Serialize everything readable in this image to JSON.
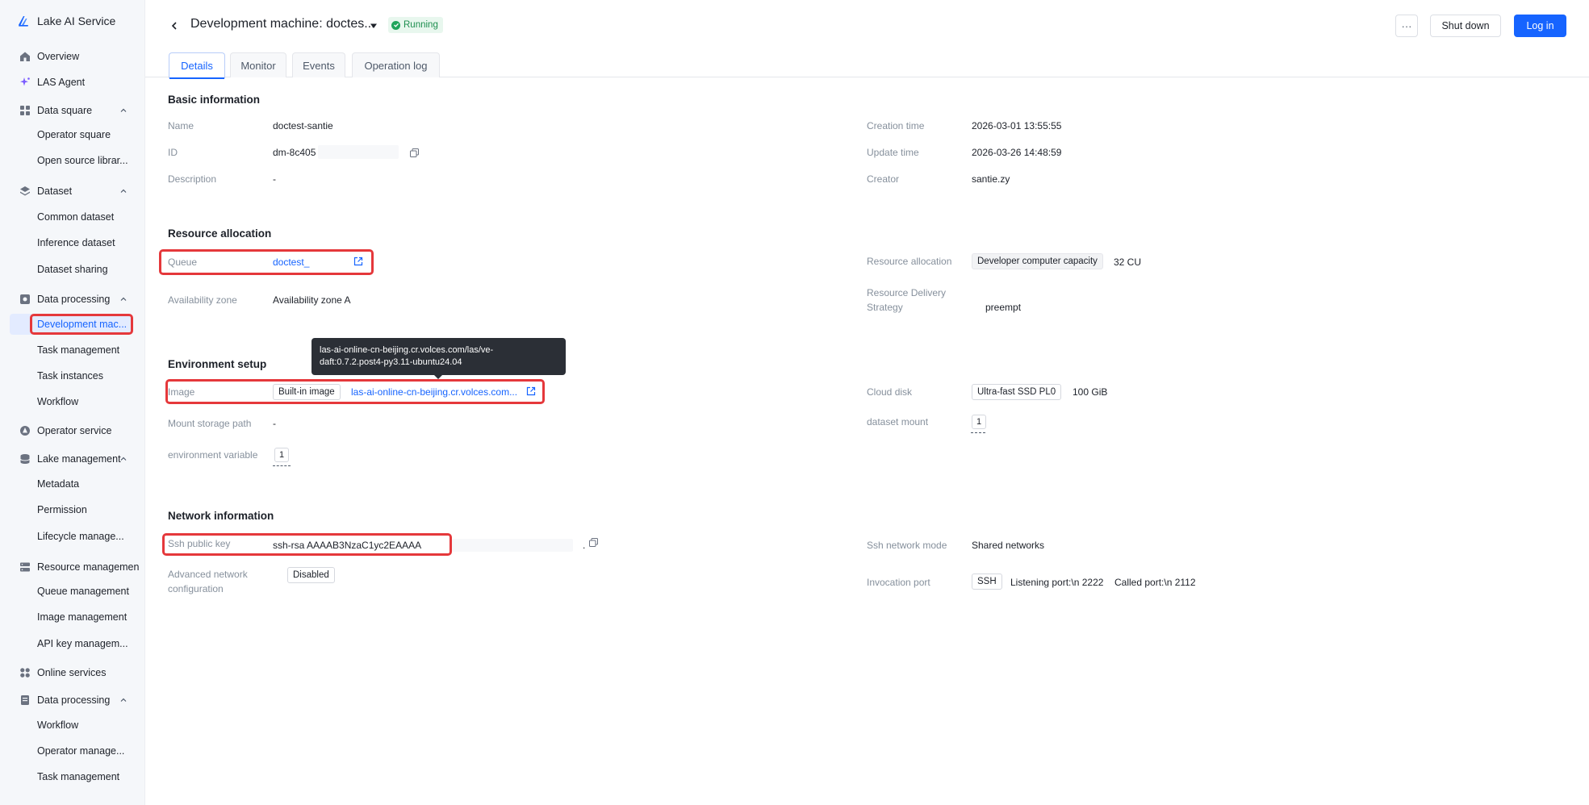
{
  "app": {
    "name": "Lake AI Service"
  },
  "sidebar": {
    "items": [
      {
        "label": "Overview",
        "icon": "home-icon"
      },
      {
        "label": "LAS Agent",
        "icon": "sparkle-icon"
      },
      {
        "label": "Data square",
        "icon": "grid-icon",
        "children": [
          "Operator square",
          "Open source librar..."
        ]
      },
      {
        "label": "Dataset",
        "icon": "layers-icon",
        "children": [
          "Common dataset",
          "Inference dataset",
          "Dataset sharing"
        ]
      },
      {
        "label": "Data processing",
        "icon": "processing-icon",
        "children": [
          "Development mac...",
          "Task management",
          "Task instances",
          "Workflow"
        ]
      },
      {
        "label": "Operator service",
        "icon": "operator-icon"
      },
      {
        "label": "Lake management",
        "icon": "database-icon",
        "children": [
          "Metadata",
          "Permission",
          "Lifecycle manage..."
        ]
      },
      {
        "label": "Resource managemen",
        "icon": "server-icon",
        "children": [
          "Queue management",
          "Image management",
          "API key managem..."
        ]
      },
      {
        "label": "Online services",
        "icon": "apps-icon"
      },
      {
        "label": "Data processing",
        "icon": "document-icon",
        "children": [
          "Workflow",
          "Operator manage...",
          "Task management"
        ]
      }
    ],
    "active": "Development mac..."
  },
  "header": {
    "title": "Development machine: doctes...",
    "status": "Running",
    "more_label": "···",
    "shutdown_label": "Shut down",
    "login_label": "Log in",
    "tabs": [
      "Details",
      "Monitor",
      "Events",
      "Operation log"
    ],
    "active_tab": "Details"
  },
  "basic": {
    "title": "Basic information",
    "name_label": "Name",
    "name": "doctest-santie",
    "id_label": "ID",
    "id": "dm-8c405",
    "desc_label": "Description",
    "desc": "-",
    "created_label": "Creation time",
    "created": "2026-03-01 13:55:55",
    "updated_label": "Update time",
    "updated": "2026-03-26 14:48:59",
    "creator_label": "Creator",
    "creator": "santie.zy"
  },
  "resource": {
    "title": "Resource allocation",
    "queue_label": "Queue",
    "queue": "doctest_",
    "zone_label": "Availability zone",
    "zone": "Availability zone A",
    "alloc_label": "Resource allocation",
    "alloc_tag": "Developer computer capacity",
    "alloc_value": "32 CU",
    "strategy_label_1": "Resource Delivery",
    "strategy_label_2": "Strategy",
    "strategy": "preempt"
  },
  "environment": {
    "title": "Environment setup",
    "image_label": "Image",
    "image_tag": "Built-in image",
    "image_link": "las-ai-online-cn-beijing.cr.volces.com...",
    "tooltip_line1": "las-ai-online-cn-beijing.cr.volces.com/las/ve-",
    "tooltip_line2": "daft:0.7.2.post4-py3.11-ubuntu24.04",
    "mount_label": "Mount storage path",
    "mount": "-",
    "env_label": "environment variable",
    "env_count": "1",
    "disk_label": "Cloud disk",
    "disk_tag": "Ultra-fast SSD PL0",
    "disk_size": "100 GiB",
    "dataset_label": "dataset mount",
    "dataset_count": "1"
  },
  "network": {
    "title": "Network information",
    "ssh_label": "Ssh public key",
    "ssh": "ssh-rsa AAAAB3NzaC1yc2EAAAA",
    "ssh_tail": ".",
    "adv_label_1": "Advanced network",
    "adv_label_2": "configuration",
    "adv": "Disabled",
    "mode_label": "Ssh network mode",
    "mode": "Shared networks",
    "port_label": "Invocation port",
    "port_tag": "SSH",
    "listen": "Listening port:\\n 2222",
    "called": "Called port:\\n 2112"
  },
  "colors": {
    "accent": "#1664ff",
    "success": "#1fa45a",
    "highlight": "#e5383b"
  }
}
